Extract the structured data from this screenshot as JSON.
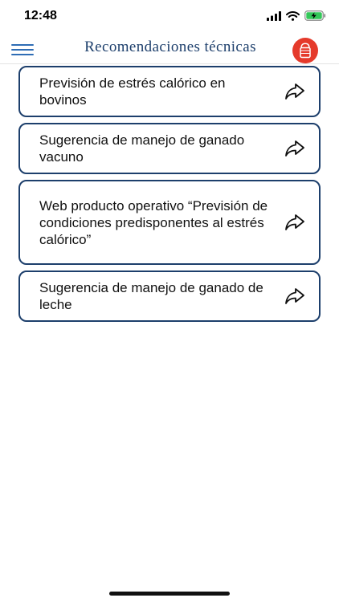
{
  "status": {
    "time": "12:48"
  },
  "header": {
    "title": "Recomendaciones técnicas",
    "brand_color": "#1d3f6c",
    "logo_color": "#e53a2b"
  },
  "items": [
    {
      "label": "Previsión de estrés calórico en bovinos"
    },
    {
      "label": "Sugerencia de manejo de ganado vacuno"
    },
    {
      "label": "Web producto operativo “Previsión de condiciones predisponentes al estrés calórico”"
    },
    {
      "label": "Sugerencia de manejo de ganado de leche"
    }
  ],
  "icons": {
    "menu": "hamburger-menu-icon",
    "item_action": "share-arrow-icon",
    "logo": "app-logo-icon"
  }
}
